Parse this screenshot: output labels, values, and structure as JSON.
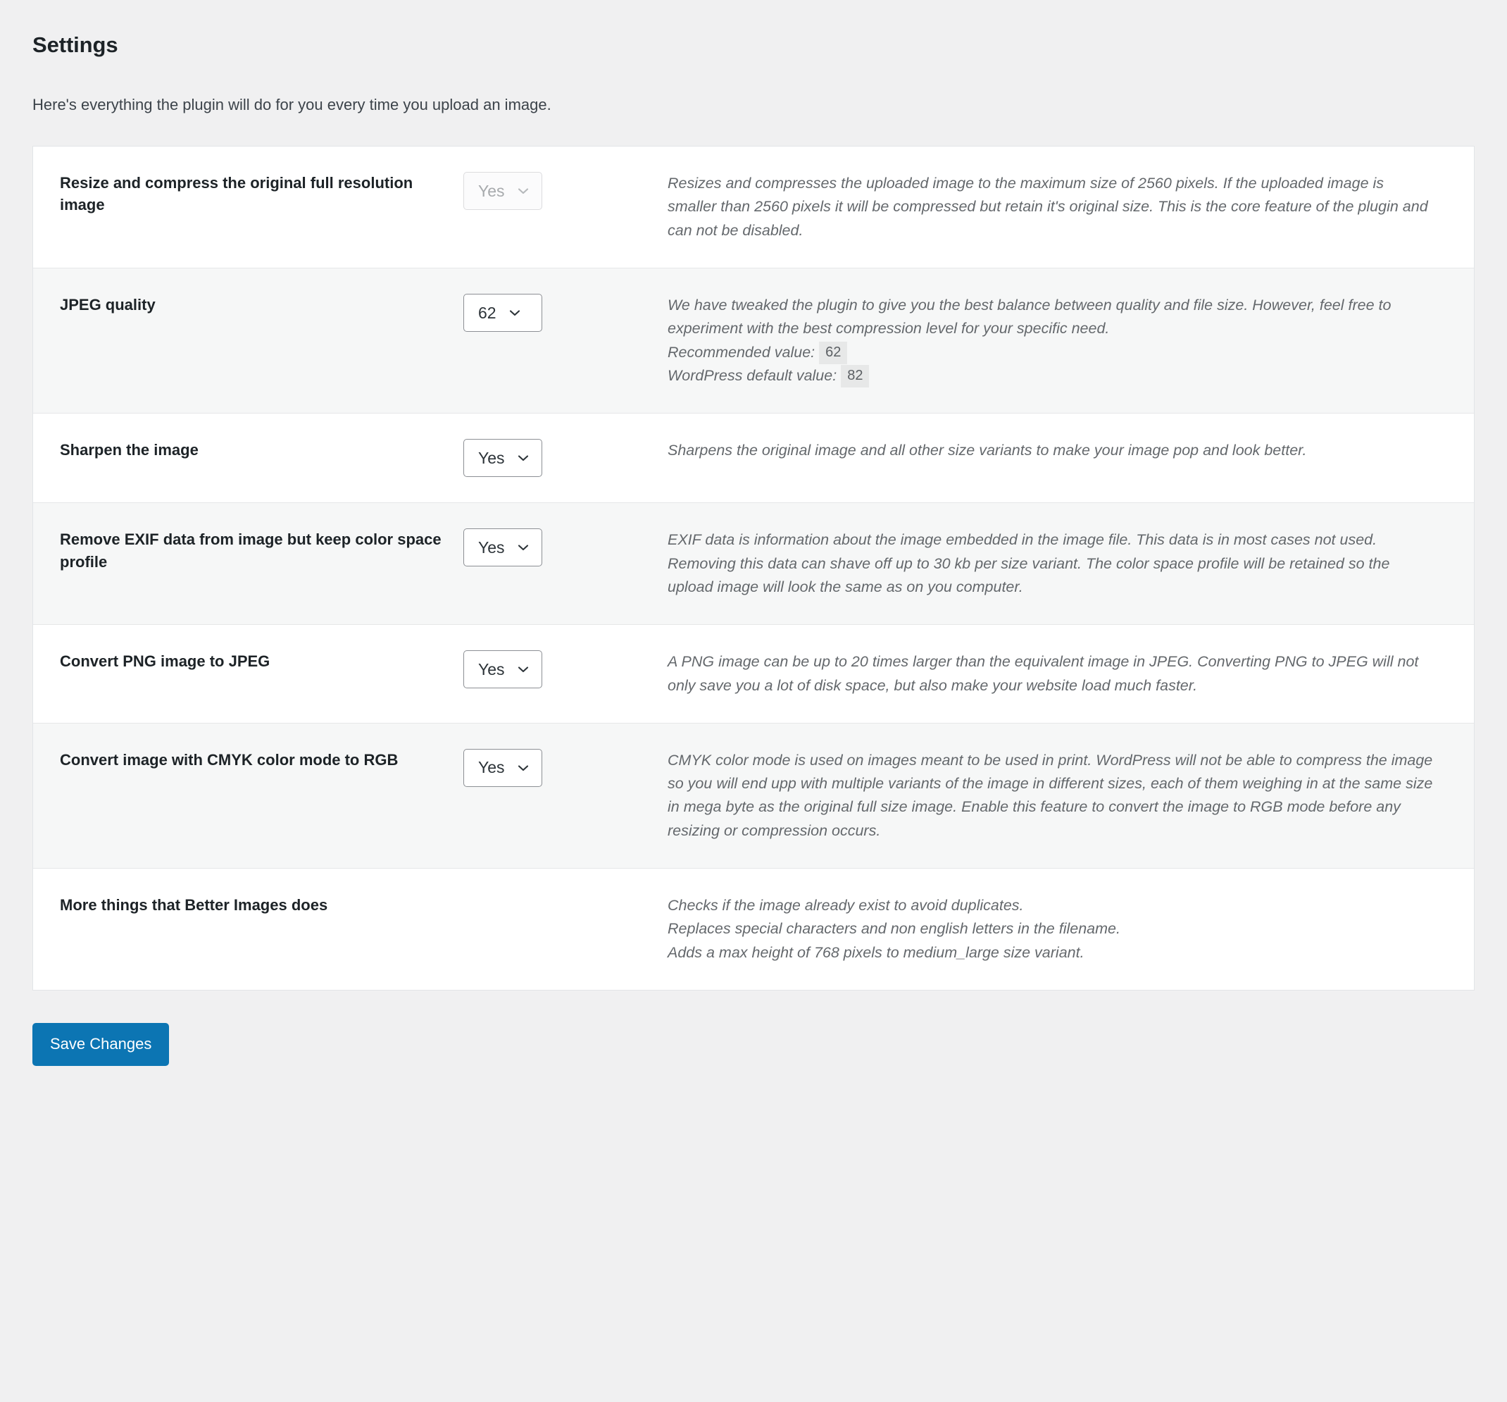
{
  "header": {
    "title": "Settings",
    "subtitle": "Here's everything the plugin will do for you every time you upload an image."
  },
  "icons": {
    "chevron_down": "chevron-down-icon"
  },
  "rows": [
    {
      "label": "Resize and compress the original full resolution image",
      "control": {
        "type": "select",
        "value": "Yes",
        "disabled": true
      },
      "description": [
        "Resizes and compresses the uploaded image to the maximum size of 2560 pixels. If the uploaded image is smaller than 2560 pixels it will be compressed but retain it's original size. This is the core feature of the plugin and can not be disabled."
      ]
    },
    {
      "label": "JPEG quality",
      "control": {
        "type": "select",
        "value": "62",
        "disabled": false
      },
      "description": [
        "We have tweaked the plugin to give you the best balance between quality and file size. However, feel free to experiment with the best compression level for your specific need."
      ],
      "value_notes": [
        {
          "label": "Recommended value:",
          "value": "62"
        },
        {
          "label": "WordPress default value:",
          "value": "82"
        }
      ]
    },
    {
      "label": "Sharpen the image",
      "control": {
        "type": "select",
        "value": "Yes",
        "disabled": false
      },
      "description": [
        "Sharpens the original image and all other size variants to make your image pop and look better."
      ]
    },
    {
      "label": "Remove EXIF data from image but keep color space profile",
      "control": {
        "type": "select",
        "value": "Yes",
        "disabled": false
      },
      "description": [
        "EXIF data is information about the image embedded in the image file. This data is in most cases not used. Removing this data can shave off up to 30 kb per size variant. The color space profile will be retained so the upload image will look the same as on you computer."
      ]
    },
    {
      "label": "Convert PNG image to JPEG",
      "control": {
        "type": "select",
        "value": "Yes",
        "disabled": false
      },
      "description": [
        "A PNG image can be up to 20 times larger than the equivalent image in JPEG. Converting PNG to JPEG will not only save you a lot of disk space, but also make your website load much faster."
      ]
    },
    {
      "label": "Convert image with CMYK color mode to RGB",
      "control": {
        "type": "select",
        "value": "Yes",
        "disabled": false
      },
      "description": [
        "CMYK color mode is used on images meant to be used in print. WordPress will not be able to compress the image so you will end upp with multiple variants of the image in different sizes, each of them weighing in at the same size in mega byte as the original full size image. Enable this feature to convert the image to RGB mode before any resizing or compression occurs."
      ]
    },
    {
      "label": "More things that Better Images does",
      "control": null,
      "description": [
        "Checks if the image already exist to avoid duplicates.",
        "Replaces special characters and non english letters in the filename.",
        "Adds a max height of 768 pixels to medium_large size variant."
      ]
    }
  ],
  "footer": {
    "save_label": "Save Changes"
  },
  "colors": {
    "accent": "#0c75b3",
    "page_bg": "#f0f0f1",
    "row_alt_bg": "#f6f7f7",
    "border": "#e2e4e7",
    "label_text": "#1d2327",
    "desc_text": "#64686c"
  }
}
